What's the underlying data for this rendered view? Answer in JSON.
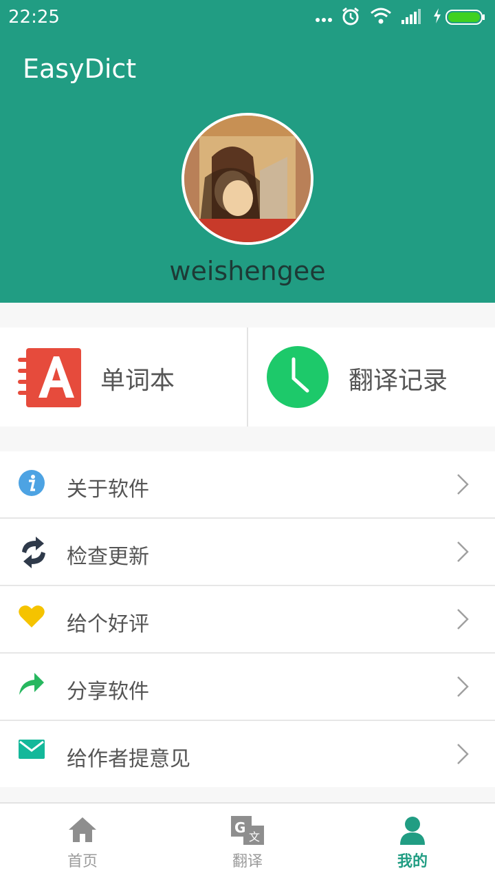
{
  "status_bar": {
    "time": "22:25"
  },
  "app": {
    "title": "EasyDict"
  },
  "profile": {
    "username": "weishengee"
  },
  "quick_actions": [
    {
      "label": "单词本",
      "icon": "wordbook-icon",
      "color": "#e64b3c"
    },
    {
      "label": "翻译记录",
      "icon": "clock-icon",
      "color": "#1dc96a"
    }
  ],
  "menu": [
    {
      "label": "关于软件",
      "icon": "info-icon"
    },
    {
      "label": "检查更新",
      "icon": "refresh-icon"
    },
    {
      "label": "给个好评",
      "icon": "heart-icon"
    },
    {
      "label": "分享软件",
      "icon": "share-icon"
    },
    {
      "label": "给作者提意见",
      "icon": "mail-icon"
    }
  ],
  "bottom_nav": [
    {
      "label": "首页",
      "icon": "home-icon",
      "active": false
    },
    {
      "label": "翻译",
      "icon": "translate-icon",
      "active": false
    },
    {
      "label": "我的",
      "icon": "person-icon",
      "active": true
    }
  ],
  "colors": {
    "primary": "#219d83",
    "active_tab": "#219d83"
  }
}
